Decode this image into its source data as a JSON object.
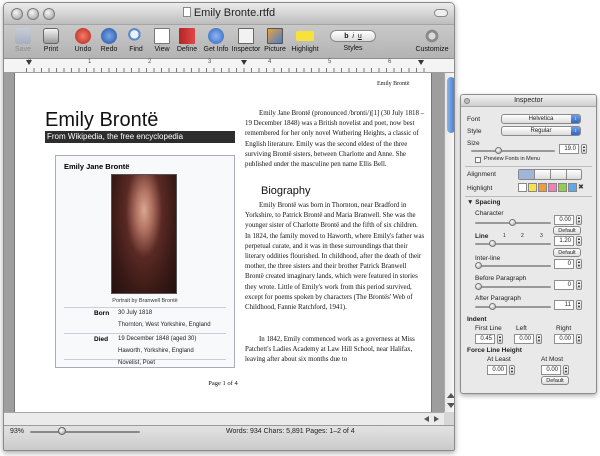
{
  "window": {
    "title": "Emily Bronte.rtfd"
  },
  "toolbar": {
    "items": [
      {
        "label": "Save",
        "icon": "save-icon"
      },
      {
        "label": "Print",
        "icon": "print-icon"
      },
      {
        "label": "Undo",
        "icon": "undo-icon"
      },
      {
        "label": "Redo",
        "icon": "redo-icon"
      },
      {
        "label": "Find",
        "icon": "find-icon"
      },
      {
        "label": "View",
        "icon": "view-icon"
      },
      {
        "label": "Define",
        "icon": "define-icon"
      },
      {
        "label": "Get Info",
        "icon": "get-info-icon"
      },
      {
        "label": "Inspector",
        "icon": "inspector-icon"
      },
      {
        "label": "Picture",
        "icon": "picture-icon"
      },
      {
        "label": "Highlight",
        "icon": "highlight-icon"
      },
      {
        "label": "Styles",
        "icon": "styles-icon"
      },
      {
        "label": "Customize",
        "icon": "customize-icon"
      }
    ],
    "styles_glyphs": [
      "b",
      "i",
      "u"
    ]
  },
  "ruler": {
    "numbers": [
      "0",
      "1",
      "2",
      "3",
      "4",
      "5",
      "6"
    ]
  },
  "document": {
    "header_right": "Emily Brontë",
    "title": "Emily Brontë",
    "subtitle": "From Wikipedia, the free encyclopedia",
    "infobox": {
      "heading": "Emily Jane Brontë",
      "caption": "Portrait by Branwell Brontë",
      "born_label": "Born",
      "born_date": "30 July 1818",
      "born_place": "Thornton, West Yorkshire, England",
      "died_label": "Died",
      "died_date": "19 December 1848 (aged 30)",
      "died_place": "Haworth, Yorkshire, England",
      "occupation": "Novelist, Poet"
    },
    "intro": "Emily Jane Brontë (pronounced /brɒnti/)[1] (30 July 1818 – 19 December 1848) was a British novelist and poet, now best remembered for her only novel Wuthering Heights, a classic of English literature. Emily was the second eldest of the three surviving Brontë sisters, between Charlotte and Anne. She published under the masculine pen name Ellis Bell.",
    "biography_heading": "Biography",
    "bio_p1": "Emily Brontë was born in Thornton, near Bradford in Yorkshire, to Patrick Brontë and Maria Branwell. She was the younger sister of Charlotte Brontë and the fifth of six children. In 1824, the family moved to Haworth, where Emily's father was perpetual curate, and it was in these surroundings that their literary oddities flourished. In childhood, after the death of their mother, the three sisters and their brother Patrick Branwell Brontë created imaginary lands, which were featured in stories they wrote. Little of Emily's work from this period survived, except for poems spoken by characters (The Brontës' Web of Childhood, Fannie Ratchford, 1941).",
    "bio_p2": "In 1842, Emily commenced work as a governess at Miss Patchett's Ladies Academy at Law Hill School, near Halifax, leaving after about six months due to",
    "page_footer": "Page 1 of 4"
  },
  "status": {
    "zoom": "93%",
    "counts": "Words: 934  Chars: 5,891  Pages: 1–2 of 4"
  },
  "inspector": {
    "title": "Inspector",
    "font_label": "Font",
    "font_value": "Helvetica",
    "style_label": "Style",
    "style_value": "Regular",
    "size_label": "Size",
    "size_value": "19.0",
    "preview_fonts": "Preview Fonts in Menu",
    "alignment_label": "Alignment",
    "highlight_label": "Highlight",
    "highlight_colors": [
      "#ffffff",
      "#f9e24a",
      "#f39a3c",
      "#f27fb6",
      "#8fd14f",
      "#5fa8ea"
    ],
    "spacing_label": "Spacing",
    "character_label": "Character",
    "character_value": "0.00",
    "line_label": "Line",
    "line_ticks": [
      "1",
      "2",
      "3"
    ],
    "line_value": "1.20",
    "interline_label": "Inter-line",
    "interline_value": "0",
    "before_paragraph_label": "Before Paragraph",
    "before_paragraph_value": "0",
    "after_paragraph_label": "After Paragraph",
    "after_paragraph_value": "11",
    "default_label": "Default",
    "indent_label": "Indent",
    "first_line_label": "First Line",
    "first_line_value": "0.45",
    "left_label": "Left",
    "left_value": "0.00",
    "right_label": "Right",
    "right_value": "0.00",
    "force_line_height_label": "Force Line Height",
    "at_least_label": "At Least",
    "at_least_value": "0.00",
    "at_most_label": "At Most",
    "at_most_value": "0.00"
  }
}
